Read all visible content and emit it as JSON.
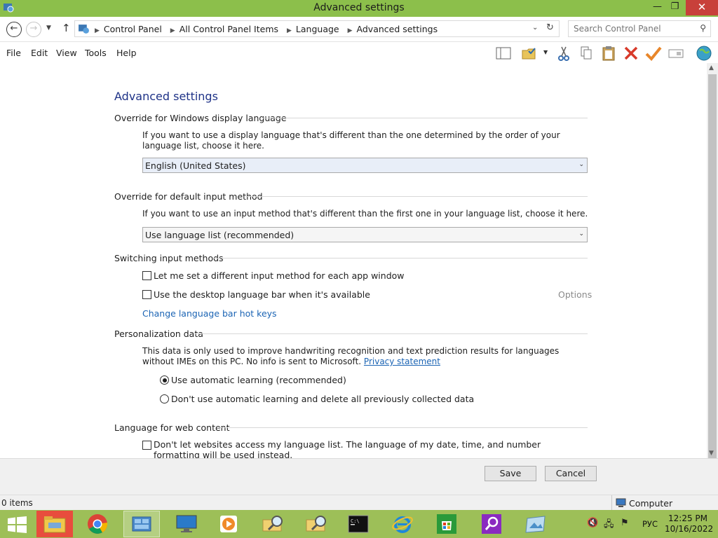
{
  "window": {
    "title": "Advanced settings",
    "minimize_glyph": "—",
    "restore_glyph": "❐",
    "close_glyph": "✕"
  },
  "address": {
    "breadcrumbs": [
      "Control Panel",
      "All Control Panel Items",
      "Language",
      "Advanced settings"
    ],
    "search_placeholder": "Search Control Panel"
  },
  "menu": [
    "File",
    "Edit",
    "View",
    "Tools",
    "Help"
  ],
  "toolbar_icons": [
    "layout-icon",
    "folder-check-icon",
    "dropdown-arrow-icon",
    "cut-icon",
    "copy-icon",
    "paste-icon",
    "delete-icon",
    "checkmark-icon",
    "rename-icon",
    "globe-icon"
  ],
  "page": {
    "heading": "Advanced settings",
    "display_language": {
      "title": "Override for Windows display language",
      "description": "If you want to use a display language that's different than the one determined by the order of your language list, choose it here.",
      "selected": "English (United States)"
    },
    "input_method": {
      "title": "Override for default input method",
      "description": "If you want to use an input method that's different than the first one in your language list, choose it here.",
      "selected": "Use language list (recommended)"
    },
    "switching": {
      "title": "Switching input methods",
      "per_app_label": "Let me set a different input method for each app window",
      "per_app_checked": false,
      "langbar_label": "Use the desktop language bar when it's available",
      "langbar_checked": false,
      "options_label": "Options",
      "hotkeys_link": "Change language bar hot keys"
    },
    "personalization": {
      "title": "Personalization data",
      "description": "This data is only used to improve handwriting recognition and text prediction results for languages without IMEs on this PC. No info is sent to Microsoft.",
      "privacy_link": "Privacy statement",
      "option_auto": "Use automatic learning (recommended)",
      "option_off": "Don't use automatic learning and delete all previously collected data",
      "selected": "auto"
    },
    "web_content": {
      "title": "Language for web content",
      "checkbox_label": "Don't let websites access my language list. The language of my date, time, and number formatting will be used instead.",
      "checked": false
    }
  },
  "buttons": {
    "save": "Save",
    "cancel": "Cancel"
  },
  "status": {
    "items": "0 items",
    "location": "Computer"
  },
  "taskbar": {
    "apps": [
      "file-explorer-icon",
      "chrome-icon",
      "control-panel-icon",
      "computer-icon",
      "media-player-icon",
      "search-folder-icon",
      "search-folder-icon",
      "command-prompt-icon",
      "internet-explorer-icon",
      "store-icon",
      "search-app-icon",
      "picture-icon"
    ],
    "language": "РУС",
    "time": "12:25 PM",
    "date": "10/16/2022"
  },
  "colors": {
    "title_bar": "#8cbf4b",
    "taskbar": "#9dbf58",
    "heading": "#1e3287",
    "link": "#1b64b4"
  }
}
